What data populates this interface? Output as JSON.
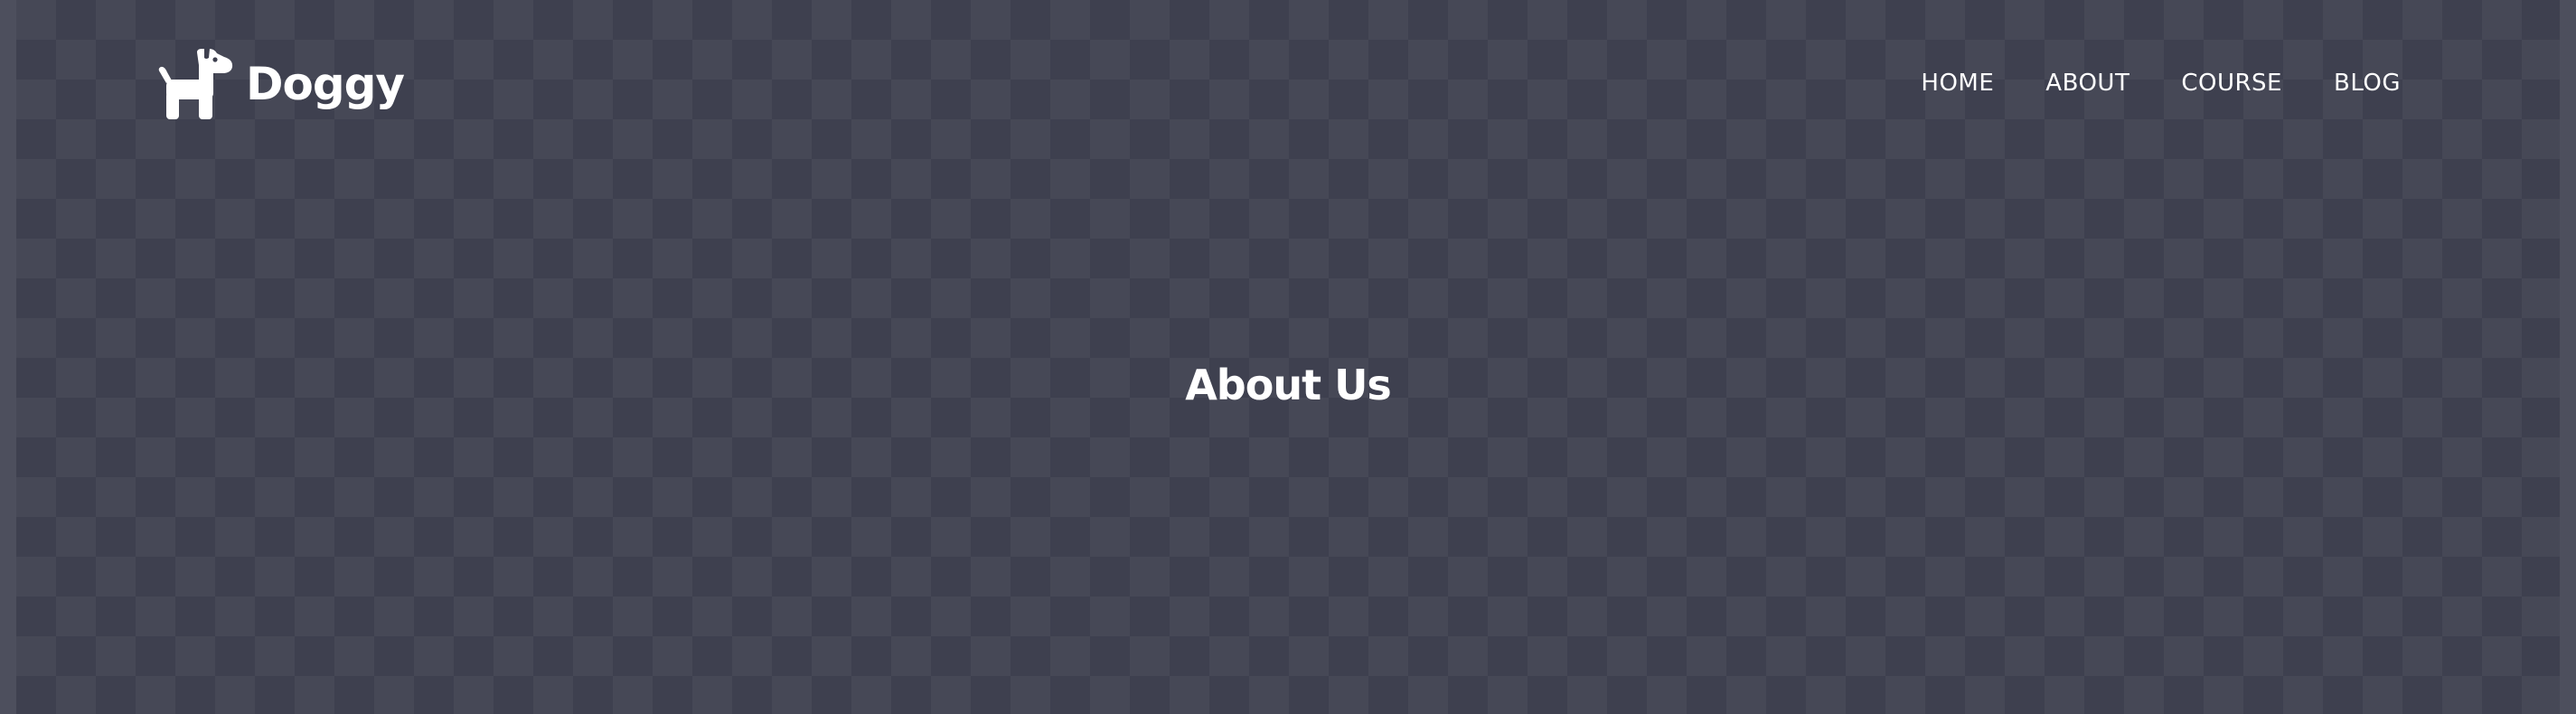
{
  "header": {
    "brand": {
      "name": "Doggy",
      "logo_icon": "dog-icon"
    },
    "nav": [
      {
        "label": "HOME"
      },
      {
        "label": "ABOUT"
      },
      {
        "label": "COURSE"
      },
      {
        "label": "BLOG"
      }
    ]
  },
  "hero": {
    "title": "About Us"
  },
  "colors": {
    "background_dark": "#3e404f",
    "background_light": "#464856",
    "text": "#ffffff"
  }
}
